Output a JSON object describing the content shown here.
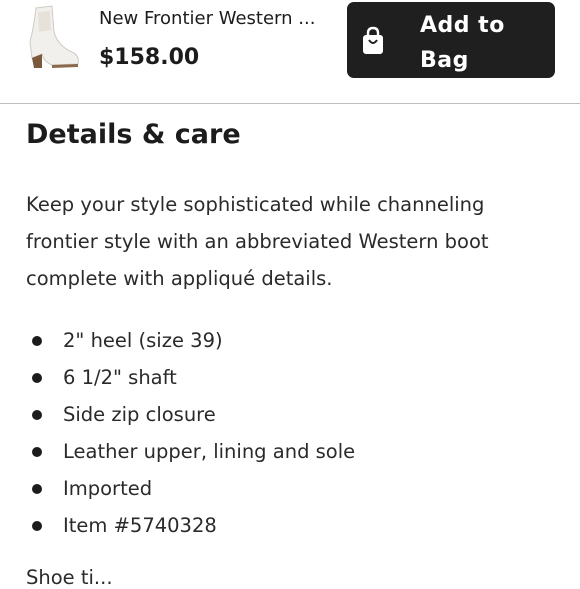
{
  "product": {
    "name": "New Frontier Western ...",
    "price": "$158.00",
    "image": "white-western-boot-thumbnail"
  },
  "add_to_bag": {
    "icon": "shopping-bag-icon",
    "line1": "Add to",
    "line2": "Bag"
  },
  "details": {
    "heading": "Details & care",
    "description": "Keep your style sophisticated while channeling frontier style with an abbreviated Western boot complete with appliqué details.",
    "features": [
      "2\" heel (size 39)",
      "6 1/2\" shaft",
      "Side zip closure",
      "Leather upper, lining and sole",
      "Imported",
      "Item #5740328"
    ]
  },
  "next_section": {
    "label": "Shoe ti..."
  }
}
